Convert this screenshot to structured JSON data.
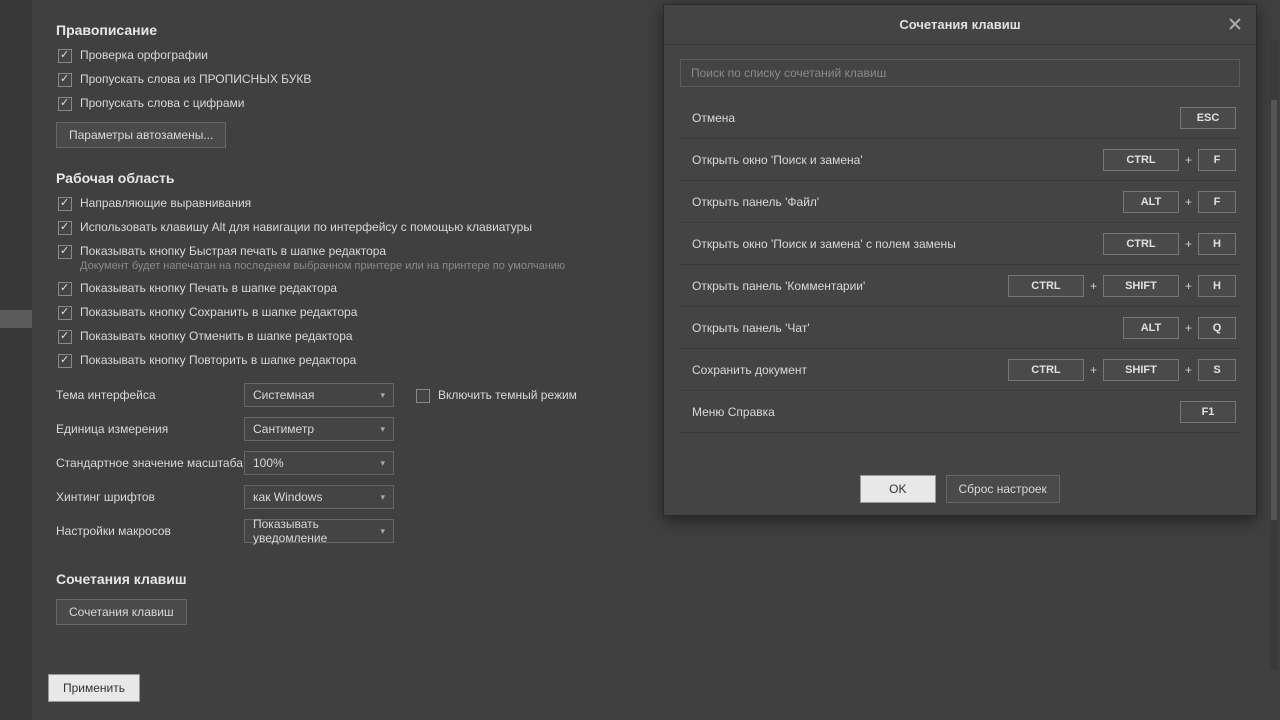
{
  "sections": {
    "spelling": {
      "title": "Правописание",
      "checks": [
        "Проверка орфографии",
        "Пропускать слова из ПРОПИСНЫХ БУКВ",
        "Пропускать слова с цифрами"
      ],
      "autocorrect_btn": "Параметры автозамены..."
    },
    "workspace": {
      "title": "Рабочая область",
      "checks": [
        {
          "label": "Направляющие выравнивания"
        },
        {
          "label": "Использовать клавишу Alt для навигации по интерфейсу с помощью клавиатуры"
        },
        {
          "label": "Показывать кнопку Быстрая печать в шапке редактора",
          "sub": "Документ будет напечатан на последнем выбранном принтере или на принтере по умолчанию"
        },
        {
          "label": "Показывать кнопку Печать в шапке редактора"
        },
        {
          "label": "Показывать кнопку Сохранить в шапке редактора"
        },
        {
          "label": "Показывать кнопку Отменить в шапке редактора"
        },
        {
          "label": "Показывать кнопку Повторить в шапке редактора"
        }
      ],
      "selects": {
        "theme": {
          "label": "Тема интерфейса",
          "value": "Системная"
        },
        "dark_mode_label": "Включить темный режим",
        "unit": {
          "label": "Единица измерения",
          "value": "Сантиметр"
        },
        "zoom": {
          "label": "Стандартное значение масштаба",
          "value": "100%"
        },
        "hinting": {
          "label": "Хинтинг шрифтов",
          "value": "как Windows"
        },
        "macros": {
          "label": "Настройки макросов",
          "value": "Показывать уведомление"
        }
      }
    },
    "shortcuts": {
      "title": "Сочетания клавиш",
      "button": "Сочетания клавиш"
    }
  },
  "apply_btn": "Применить",
  "modal": {
    "title": "Сочетания клавиш",
    "search_placeholder": "Поиск по списку сочетаний клавиш",
    "rows": [
      {
        "action": "Отмена",
        "keys": [
          "ESC"
        ]
      },
      {
        "action": "Открыть окно 'Поиск и замена'",
        "keys": [
          "CTRL",
          "F"
        ]
      },
      {
        "action": "Открыть панель 'Файл'",
        "keys": [
          "ALT",
          "F"
        ]
      },
      {
        "action": "Открыть окно 'Поиск и замена' с полем замены",
        "keys": [
          "CTRL",
          "H"
        ]
      },
      {
        "action": "Открыть панель 'Комментарии'",
        "keys": [
          "CTRL",
          "SHIFT",
          "H"
        ]
      },
      {
        "action": "Открыть панель 'Чат'",
        "keys": [
          "ALT",
          "Q"
        ]
      },
      {
        "action": "Сохранить документ",
        "keys": [
          "CTRL",
          "SHIFT",
          "S"
        ]
      },
      {
        "action": "Меню Справка",
        "keys": [
          "F1"
        ]
      }
    ],
    "ok": "OK",
    "reset": "Сброс настроек"
  }
}
